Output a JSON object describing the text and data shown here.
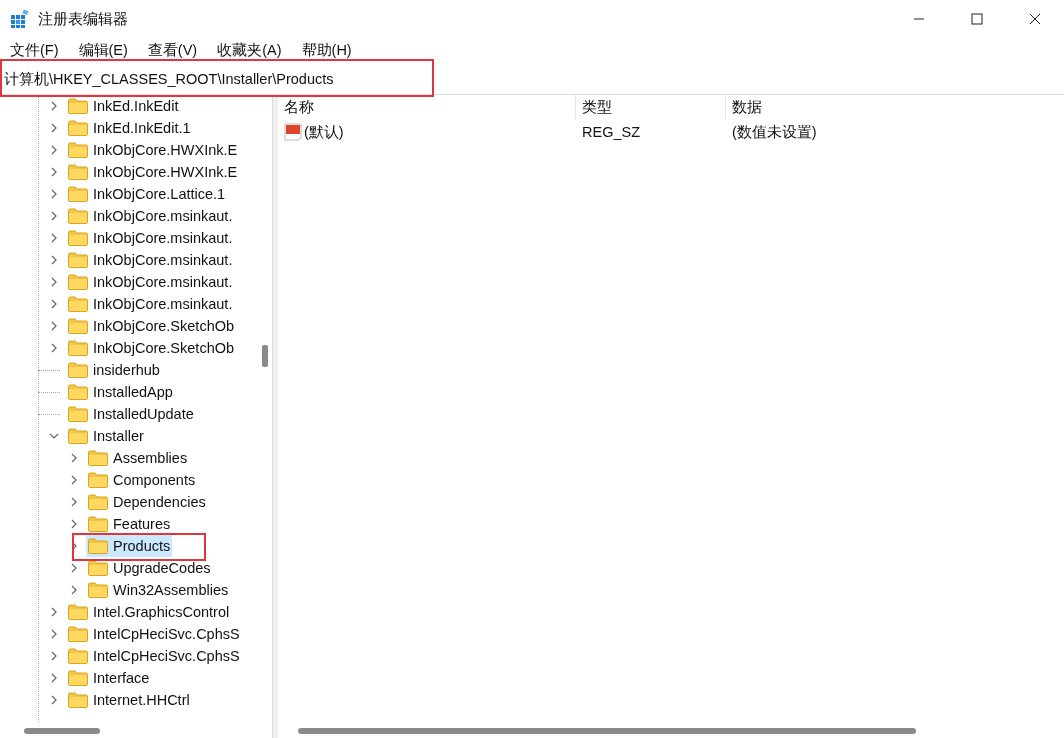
{
  "window": {
    "title": "注册表编辑器"
  },
  "menu": [
    "文件(F)",
    "编辑(E)",
    "查看(V)",
    "收藏夹(A)",
    "帮助(H)"
  ],
  "address": "计算机\\HKEY_CLASSES_ROOT\\Installer\\Products",
  "tree": [
    {
      "label": "InkEd.InkEdit",
      "expandable": true,
      "expanded": false,
      "selected": false
    },
    {
      "label": "InkEd.InkEdit.1",
      "expandable": true,
      "expanded": false,
      "selected": false
    },
    {
      "label": "InkObjCore.HWXInk.E",
      "expandable": true,
      "expanded": false,
      "selected": false
    },
    {
      "label": "InkObjCore.HWXInk.E",
      "expandable": true,
      "expanded": false,
      "selected": false
    },
    {
      "label": "InkObjCore.Lattice.1",
      "expandable": true,
      "expanded": false,
      "selected": false
    },
    {
      "label": "InkObjCore.msinkaut.",
      "expandable": true,
      "expanded": false,
      "selected": false
    },
    {
      "label": "InkObjCore.msinkaut.",
      "expandable": true,
      "expanded": false,
      "selected": false
    },
    {
      "label": "InkObjCore.msinkaut.",
      "expandable": true,
      "expanded": false,
      "selected": false
    },
    {
      "label": "InkObjCore.msinkaut.",
      "expandable": true,
      "expanded": false,
      "selected": false
    },
    {
      "label": "InkObjCore.msinkaut.",
      "expandable": true,
      "expanded": false,
      "selected": false
    },
    {
      "label": "InkObjCore.SketchOb",
      "expandable": true,
      "expanded": false,
      "selected": false
    },
    {
      "label": "InkObjCore.SketchOb",
      "expandable": true,
      "expanded": false,
      "selected": false
    },
    {
      "label": "insiderhub",
      "expandable": false,
      "selected": false
    },
    {
      "label": "InstalledApp",
      "expandable": false,
      "selected": false
    },
    {
      "label": "InstalledUpdate",
      "expandable": false,
      "selected": false
    },
    {
      "label": "Installer",
      "expandable": true,
      "expanded": true,
      "selected": false,
      "children": [
        {
          "label": "Assemblies",
          "expandable": true,
          "expanded": false,
          "selected": false
        },
        {
          "label": "Components",
          "expandable": true,
          "expanded": false,
          "selected": false
        },
        {
          "label": "Dependencies",
          "expandable": true,
          "expanded": false,
          "selected": false
        },
        {
          "label": "Features",
          "expandable": true,
          "expanded": false,
          "selected": false
        },
        {
          "label": "Products",
          "expandable": true,
          "expanded": false,
          "selected": true
        },
        {
          "label": "UpgradeCodes",
          "expandable": true,
          "expanded": false,
          "selected": false
        },
        {
          "label": "Win32Assemblies",
          "expandable": true,
          "expanded": false,
          "selected": false
        }
      ]
    },
    {
      "label": "Intel.GraphicsControl",
      "expandable": true,
      "expanded": false,
      "selected": false
    },
    {
      "label": "IntelCpHeciSvc.CphsS",
      "expandable": true,
      "expanded": false,
      "selected": false
    },
    {
      "label": "IntelCpHeciSvc.CphsS",
      "expandable": true,
      "expanded": false,
      "selected": false
    },
    {
      "label": "Interface",
      "expandable": true,
      "expanded": false,
      "selected": false
    },
    {
      "label": "Internet.HHCtrl",
      "expandable": true,
      "expanded": false,
      "selected": false
    }
  ],
  "values": {
    "columns": [
      "名称",
      "类型",
      "数据"
    ],
    "rows": [
      {
        "name": "(默认)",
        "type": "REG_SZ",
        "data": "(数值未设置)"
      }
    ]
  }
}
